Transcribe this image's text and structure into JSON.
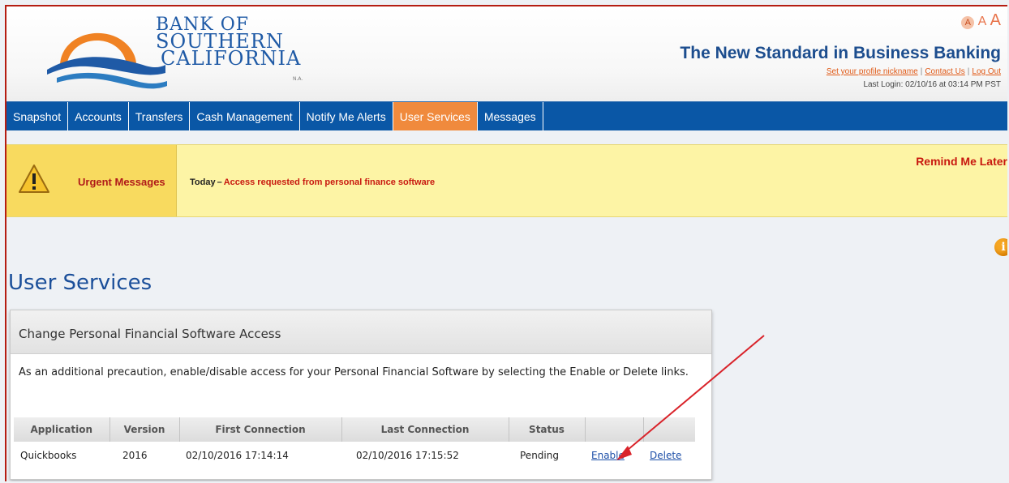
{
  "header": {
    "logo": {
      "line1": "BANK OF",
      "line2": "SOUTHERN",
      "line3": "CALIFORNIA",
      "suffix": "N.A."
    },
    "font_sizer": {
      "small": "A",
      "medium": "A",
      "large": "A"
    },
    "tagline": "The New Standard in Business Banking",
    "profile_links": {
      "nickname": "Set your profile nickname",
      "contact": "Contact Us",
      "logout": "Log Out",
      "separator": "|"
    },
    "last_login": "Last Login: 02/10/16 at 03:14 PM PST"
  },
  "nav": {
    "items": [
      {
        "label": "Snapshot"
      },
      {
        "label": "Accounts"
      },
      {
        "label": "Transfers"
      },
      {
        "label": "Cash Management"
      },
      {
        "label": "Notify Me Alerts"
      },
      {
        "label": "User Services"
      },
      {
        "label": "Messages"
      }
    ],
    "active": "User Services"
  },
  "urgent": {
    "label": "Urgent Messages",
    "when": "Today",
    "dash": "–",
    "message": "Access requested from personal finance software",
    "remind": "Remind Me Later"
  },
  "page": {
    "title": "User Services",
    "info_icon": "i"
  },
  "panel": {
    "title": "Change Personal Financial Software Access",
    "description": "As an additional precaution, enable/disable access for your Personal Financial Software by selecting the Enable or Delete links.",
    "columns": [
      "Application",
      "Version",
      "First Connection",
      "Last Connection",
      "Status",
      "",
      ""
    ],
    "rows": [
      {
        "application": "Quickbooks",
        "version": "2016",
        "first_connection": "02/10/2016 17:14:14",
        "last_connection": "02/10/2016 17:15:52",
        "status": "Pending",
        "enable": "Enable",
        "delete": "Delete"
      }
    ]
  },
  "colors": {
    "nav_blue": "#0a57a6",
    "active_orange": "#f08a3d",
    "alert_red": "#c8180f",
    "title_blue": "#1b4f9a",
    "annotation_arrow": "#d9232a"
  }
}
